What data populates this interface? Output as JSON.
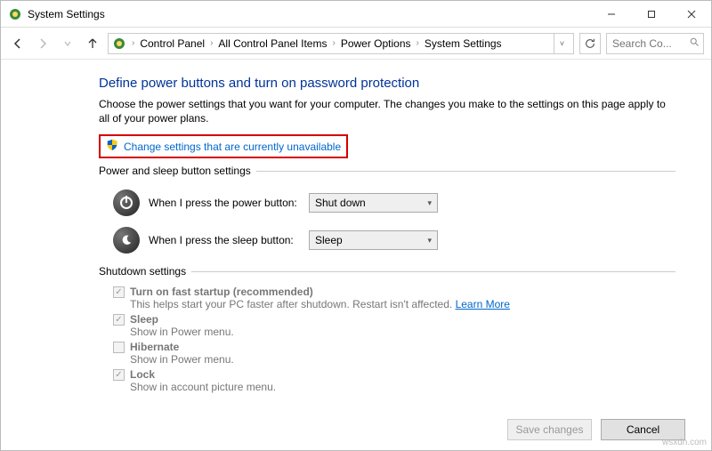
{
  "window": {
    "title": "System Settings"
  },
  "breadcrumb": {
    "items": [
      "Control Panel",
      "All Control Panel Items",
      "Power Options",
      "System Settings"
    ]
  },
  "search": {
    "placeholder": "Search Co...",
    "icon": "search-icon"
  },
  "page": {
    "heading": "Define power buttons and turn on password protection",
    "subtext": "Choose the power settings that you want for your computer. The changes you make to the settings on this page apply to all of your power plans.",
    "uac_link": "Change settings that are currently unavailable"
  },
  "power_sleep": {
    "legend": "Power and sleep button settings",
    "rows": [
      {
        "label": "When I press the power button:",
        "value": "Shut down"
      },
      {
        "label": "When I press the sleep button:",
        "value": "Sleep"
      }
    ]
  },
  "shutdown": {
    "legend": "Shutdown settings",
    "items": [
      {
        "label": "Turn on fast startup (recommended)",
        "desc_pre": "This helps start your PC faster after shutdown. Restart isn't affected. ",
        "link": "Learn More",
        "checked": true
      },
      {
        "label": "Sleep",
        "desc_pre": "Show in Power menu.",
        "link": "",
        "checked": true
      },
      {
        "label": "Hibernate",
        "desc_pre": "Show in Power menu.",
        "link": "",
        "checked": false
      },
      {
        "label": "Lock",
        "desc_pre": "Show in account picture menu.",
        "link": "",
        "checked": true
      }
    ]
  },
  "footer": {
    "save": "Save changes",
    "cancel": "Cancel"
  },
  "watermark": "wsxdn.com"
}
